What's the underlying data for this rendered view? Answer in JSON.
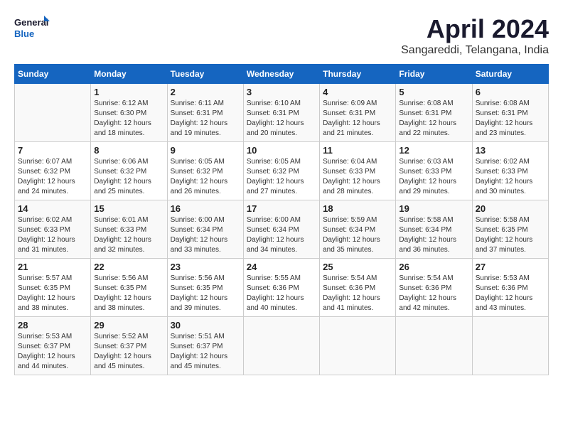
{
  "header": {
    "logo_line1": "General",
    "logo_line2": "Blue",
    "month": "April 2024",
    "location": "Sangareddi, Telangana, India"
  },
  "days_of_week": [
    "Sunday",
    "Monday",
    "Tuesday",
    "Wednesday",
    "Thursday",
    "Friday",
    "Saturday"
  ],
  "weeks": [
    [
      {
        "day": "",
        "info": ""
      },
      {
        "day": "1",
        "info": "Sunrise: 6:12 AM\nSunset: 6:30 PM\nDaylight: 12 hours\nand 18 minutes."
      },
      {
        "day": "2",
        "info": "Sunrise: 6:11 AM\nSunset: 6:31 PM\nDaylight: 12 hours\nand 19 minutes."
      },
      {
        "day": "3",
        "info": "Sunrise: 6:10 AM\nSunset: 6:31 PM\nDaylight: 12 hours\nand 20 minutes."
      },
      {
        "day": "4",
        "info": "Sunrise: 6:09 AM\nSunset: 6:31 PM\nDaylight: 12 hours\nand 21 minutes."
      },
      {
        "day": "5",
        "info": "Sunrise: 6:08 AM\nSunset: 6:31 PM\nDaylight: 12 hours\nand 22 minutes."
      },
      {
        "day": "6",
        "info": "Sunrise: 6:08 AM\nSunset: 6:31 PM\nDaylight: 12 hours\nand 23 minutes."
      }
    ],
    [
      {
        "day": "7",
        "info": "Sunrise: 6:07 AM\nSunset: 6:32 PM\nDaylight: 12 hours\nand 24 minutes."
      },
      {
        "day": "8",
        "info": "Sunrise: 6:06 AM\nSunset: 6:32 PM\nDaylight: 12 hours\nand 25 minutes."
      },
      {
        "day": "9",
        "info": "Sunrise: 6:05 AM\nSunset: 6:32 PM\nDaylight: 12 hours\nand 26 minutes."
      },
      {
        "day": "10",
        "info": "Sunrise: 6:05 AM\nSunset: 6:32 PM\nDaylight: 12 hours\nand 27 minutes."
      },
      {
        "day": "11",
        "info": "Sunrise: 6:04 AM\nSunset: 6:33 PM\nDaylight: 12 hours\nand 28 minutes."
      },
      {
        "day": "12",
        "info": "Sunrise: 6:03 AM\nSunset: 6:33 PM\nDaylight: 12 hours\nand 29 minutes."
      },
      {
        "day": "13",
        "info": "Sunrise: 6:02 AM\nSunset: 6:33 PM\nDaylight: 12 hours\nand 30 minutes."
      }
    ],
    [
      {
        "day": "14",
        "info": "Sunrise: 6:02 AM\nSunset: 6:33 PM\nDaylight: 12 hours\nand 31 minutes."
      },
      {
        "day": "15",
        "info": "Sunrise: 6:01 AM\nSunset: 6:33 PM\nDaylight: 12 hours\nand 32 minutes."
      },
      {
        "day": "16",
        "info": "Sunrise: 6:00 AM\nSunset: 6:34 PM\nDaylight: 12 hours\nand 33 minutes."
      },
      {
        "day": "17",
        "info": "Sunrise: 6:00 AM\nSunset: 6:34 PM\nDaylight: 12 hours\nand 34 minutes."
      },
      {
        "day": "18",
        "info": "Sunrise: 5:59 AM\nSunset: 6:34 PM\nDaylight: 12 hours\nand 35 minutes."
      },
      {
        "day": "19",
        "info": "Sunrise: 5:58 AM\nSunset: 6:34 PM\nDaylight: 12 hours\nand 36 minutes."
      },
      {
        "day": "20",
        "info": "Sunrise: 5:58 AM\nSunset: 6:35 PM\nDaylight: 12 hours\nand 37 minutes."
      }
    ],
    [
      {
        "day": "21",
        "info": "Sunrise: 5:57 AM\nSunset: 6:35 PM\nDaylight: 12 hours\nand 38 minutes."
      },
      {
        "day": "22",
        "info": "Sunrise: 5:56 AM\nSunset: 6:35 PM\nDaylight: 12 hours\nand 38 minutes."
      },
      {
        "day": "23",
        "info": "Sunrise: 5:56 AM\nSunset: 6:35 PM\nDaylight: 12 hours\nand 39 minutes."
      },
      {
        "day": "24",
        "info": "Sunrise: 5:55 AM\nSunset: 6:36 PM\nDaylight: 12 hours\nand 40 minutes."
      },
      {
        "day": "25",
        "info": "Sunrise: 5:54 AM\nSunset: 6:36 PM\nDaylight: 12 hours\nand 41 minutes."
      },
      {
        "day": "26",
        "info": "Sunrise: 5:54 AM\nSunset: 6:36 PM\nDaylight: 12 hours\nand 42 minutes."
      },
      {
        "day": "27",
        "info": "Sunrise: 5:53 AM\nSunset: 6:36 PM\nDaylight: 12 hours\nand 43 minutes."
      }
    ],
    [
      {
        "day": "28",
        "info": "Sunrise: 5:53 AM\nSunset: 6:37 PM\nDaylight: 12 hours\nand 44 minutes."
      },
      {
        "day": "29",
        "info": "Sunrise: 5:52 AM\nSunset: 6:37 PM\nDaylight: 12 hours\nand 45 minutes."
      },
      {
        "day": "30",
        "info": "Sunrise: 5:51 AM\nSunset: 6:37 PM\nDaylight: 12 hours\nand 45 minutes."
      },
      {
        "day": "",
        "info": ""
      },
      {
        "day": "",
        "info": ""
      },
      {
        "day": "",
        "info": ""
      },
      {
        "day": "",
        "info": ""
      }
    ]
  ]
}
